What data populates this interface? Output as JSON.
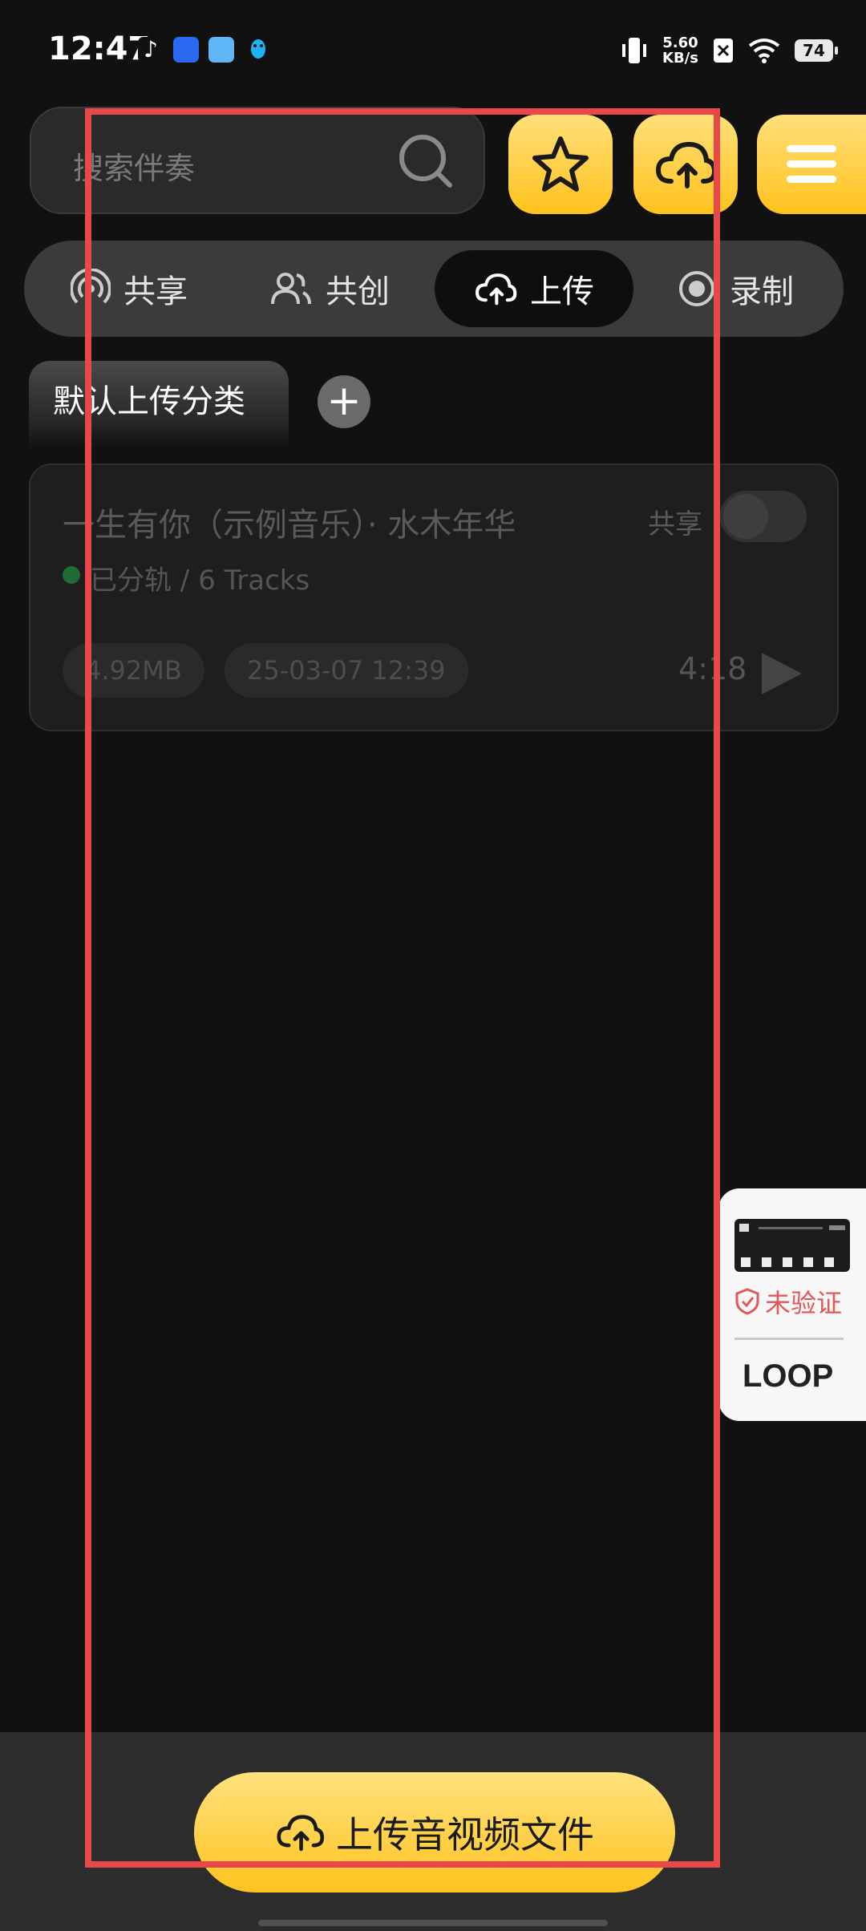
{
  "status_bar": {
    "time": "12:47",
    "net_speed_value": "5.60",
    "net_speed_unit": "KB/s",
    "battery": "74"
  },
  "search": {
    "placeholder": "搜索伴奏"
  },
  "tabs": [
    {
      "label": "共享",
      "icon": "broadcast-icon"
    },
    {
      "label": "共创",
      "icon": "users-icon"
    },
    {
      "label": "上传",
      "icon": "cloud-upload-icon",
      "active": true
    },
    {
      "label": "录制",
      "icon": "record-icon"
    }
  ],
  "category": {
    "label": "默认上传分类"
  },
  "track": {
    "title": "一生有你（示例音乐）· 水木年华",
    "share_label": "共享",
    "status": "已分轨 / 6 Tracks",
    "size": "4.92MB",
    "date": "25-03-07 12:39",
    "duration": "4:18"
  },
  "loop_widget": {
    "verify_text": "未验证",
    "label": "LOOP"
  },
  "upload_button": {
    "label": "上传音视频文件"
  },
  "colors": {
    "accent": "#ffc21d",
    "active_tab": "#0e0e0e",
    "annotation": "#e8484a"
  }
}
